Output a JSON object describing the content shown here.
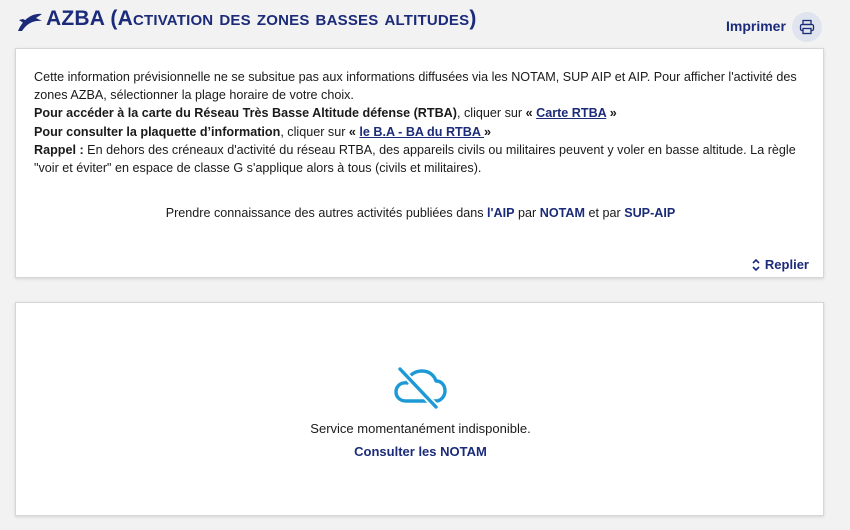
{
  "header": {
    "title": "AZBA (Activation des zones basses altitudes)",
    "print_label": "Imprimer"
  },
  "info": {
    "p1": "Cette information prévisionnelle ne se subsitue pas aux informations diffusées via les NOTAM, SUP AIP et AIP. Pour afficher l'activité des zones AZBA, sélectionner la plage horaire de votre choix.",
    "p2_bold": "Pour accéder à la carte du Réseau Très Basse Altitude défense (RTBA)",
    "p2_mid": ", cliquer sur ",
    "p2_open": "« ",
    "p2_link": "Carte RTBA",
    "p2_close": " »",
    "p3_bold": "Pour consulter la plaquette d’information",
    "p3_mid": ", cliquer sur ",
    "p3_open": "« ",
    "p3_link": "le B.A - BA du RTBA ",
    "p3_close": "»",
    "p4_bold": "Rappel :",
    "p4_text": " En dehors des créneaux d'activité du réseau RTBA, des appareils civils ou militaires peuvent y voler en basse altitude. La règle \"voir et éviter\" en espace de classe G s'applique alors à tous (civils et militaires).",
    "pub_prefix": "Prendre connaissance des autres activités publiées dans ",
    "pub_aip": "l'AIP",
    "pub_par1": " par ",
    "pub_notam": "NOTAM",
    "pub_par2": " et par ",
    "pub_sup": "SUP-AIP",
    "collapse_label": "Replier"
  },
  "status": {
    "message": "Service momentanément indisponible.",
    "link": "Consulter les NOTAM"
  },
  "colors": {
    "brand": "#1b2b7a",
    "icon_blue": "#1d9ad6",
    "background": "#f2f2f2"
  },
  "icons": {
    "logo": "plane-logo-icon",
    "print": "printer-icon",
    "collapse": "chevron-up-down-icon",
    "status": "cloud-off-icon"
  }
}
